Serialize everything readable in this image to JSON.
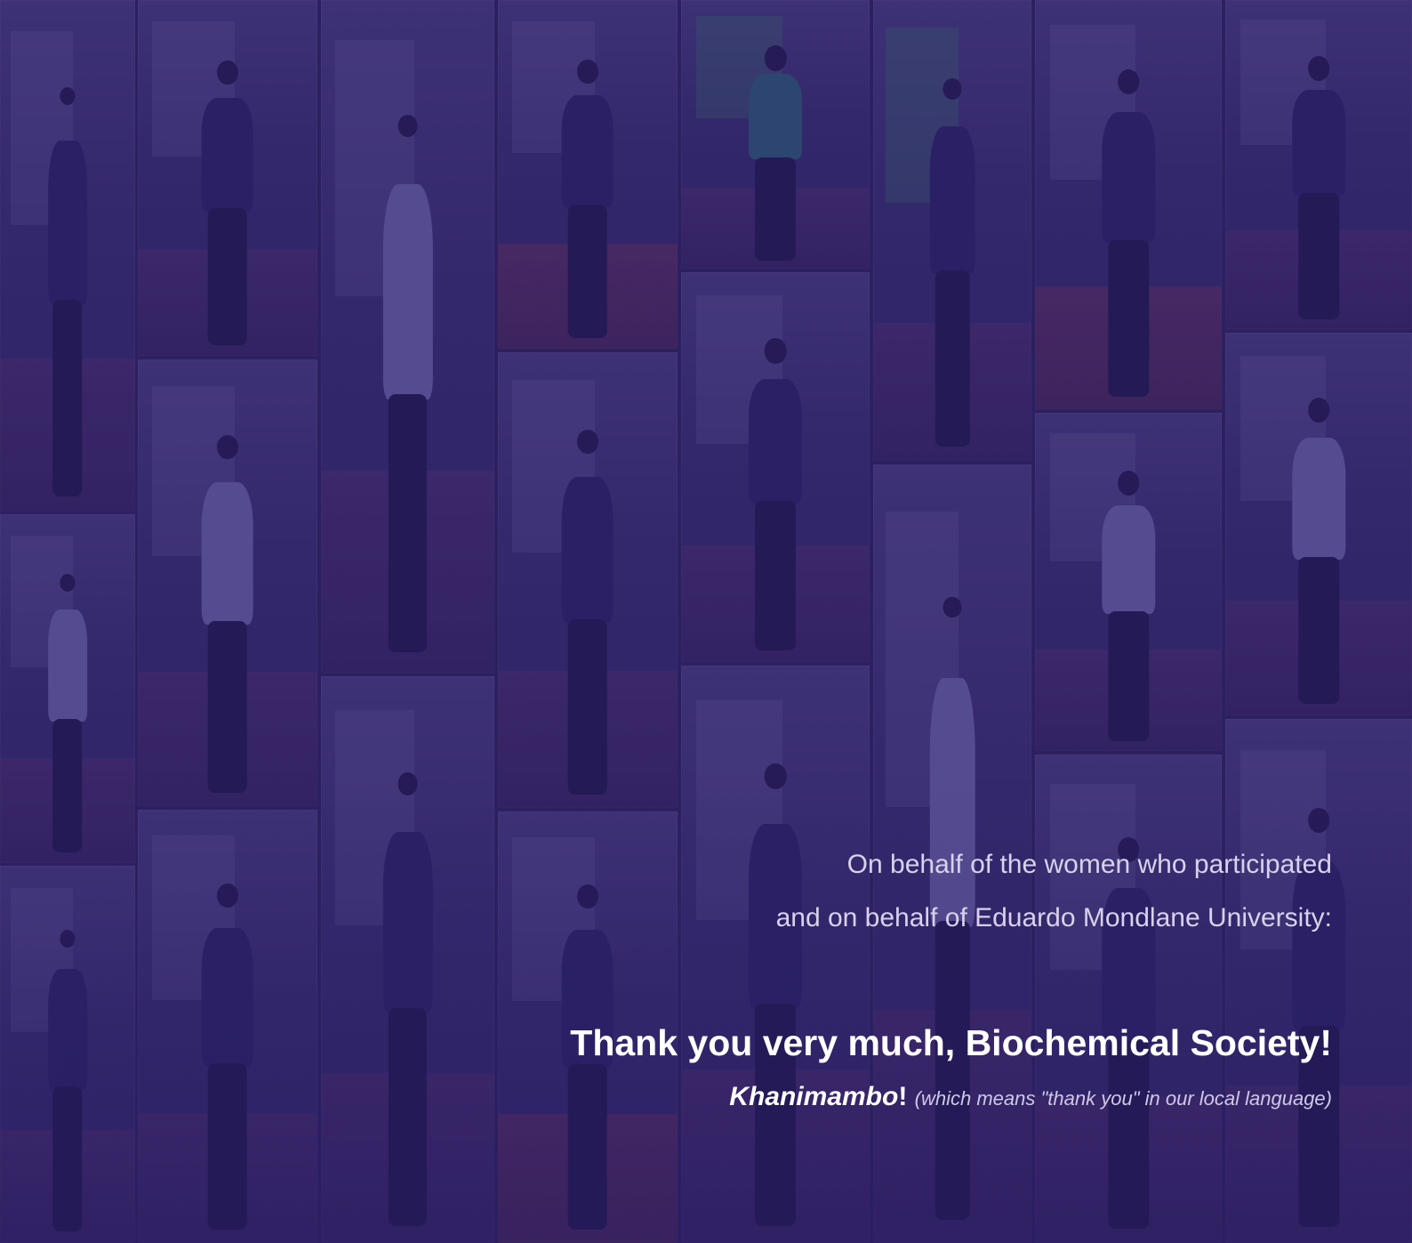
{
  "background": {
    "overlay_color": "#2e2260",
    "description_icon": "photo-collage"
  },
  "message": {
    "line1": "On behalf of the women who participated",
    "line2": "and on behalf of Eduardo Mondlane University:",
    "headline": "Thank you very much, Biochemical Society!",
    "khanimambo_word": "Khanimambo",
    "khanimambo_punct": "!",
    "khanimambo_note": "(which means \"thank you\" in our local language)"
  },
  "colors": {
    "text_primary": "#ffffff",
    "text_secondary": "#d8d2ec",
    "overlay": "#2e2260"
  }
}
